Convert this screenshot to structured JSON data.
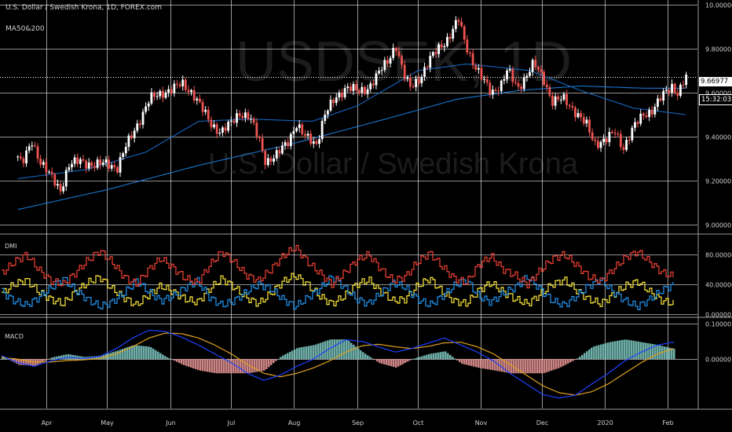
{
  "header": {
    "symbol_title": "U.S. Dollar / Swedish Krona, 1D, FOREX.com",
    "study_label": "MA50&200",
    "watermark_symbol": "USDSEK, 1D",
    "watermark_name": "U.S. Dollar / Swedish Krona"
  },
  "price_boxes": {
    "last_price": "9.66977",
    "countdown": "15:32:03"
  },
  "colors": {
    "background": "#000000",
    "grid": "#ffffff",
    "candle_up": "#ffffff",
    "candle_down": "#ef5350",
    "ma50": "#1565c0",
    "ma200": "#1976d2",
    "di_plus": "#2196f3",
    "di_minus": "#f44336",
    "adx": "#ffeb3b",
    "macd_line": "#1e40ff",
    "signal_line": "#e0a020",
    "hist_pos": "#80cbc4",
    "hist_neg": "#ef9a9a"
  },
  "chart_data": [
    {
      "type": "candlestick",
      "title": "U.S. Dollar / Swedish Krona, 1D, FOREX.com",
      "x_tick_labels": [
        "Apr",
        "May",
        "Jun",
        "Jul",
        "Aug",
        "Sep",
        "Oct",
        "Nov",
        "Dec",
        "2020",
        "Feb"
      ],
      "y_tick_labels": [
        "9.00000",
        "9.20000",
        "9.40000",
        "9.60000",
        "9.80000",
        "10.00000"
      ],
      "ylim": [
        8.98,
        10.02
      ],
      "close_path": [
        [
          "2019-03-18",
          9.31
        ],
        [
          "2019-03-20",
          9.27
        ],
        [
          "2019-03-25",
          9.38
        ],
        [
          "2019-03-29",
          9.29
        ],
        [
          "2019-04-03",
          9.22
        ],
        [
          "2019-04-08",
          9.16
        ],
        [
          "2019-04-12",
          9.27
        ],
        [
          "2019-04-18",
          9.29
        ],
        [
          "2019-04-25",
          9.27
        ],
        [
          "2019-05-01",
          9.28
        ],
        [
          "2019-05-06",
          9.26
        ],
        [
          "2019-05-10",
          9.35
        ],
        [
          "2019-05-16",
          9.46
        ],
        [
          "2019-05-22",
          9.57
        ],
        [
          "2019-05-28",
          9.6
        ],
        [
          "2019-06-03",
          9.62
        ],
        [
          "2019-06-07",
          9.64
        ],
        [
          "2019-06-12",
          9.6
        ],
        [
          "2019-06-17",
          9.52
        ],
        [
          "2019-06-21",
          9.46
        ],
        [
          "2019-06-26",
          9.42
        ],
        [
          "2019-07-01",
          9.46
        ],
        [
          "2019-07-05",
          9.51
        ],
        [
          "2019-07-10",
          9.49
        ],
        [
          "2019-07-15",
          9.38
        ],
        [
          "2019-07-18",
          9.29
        ],
        [
          "2019-07-23",
          9.31
        ],
        [
          "2019-07-29",
          9.38
        ],
        [
          "2019-08-02",
          9.46
        ],
        [
          "2019-08-06",
          9.4
        ],
        [
          "2019-08-12",
          9.37
        ],
        [
          "2019-08-16",
          9.5
        ],
        [
          "2019-08-22",
          9.58
        ],
        [
          "2019-08-27",
          9.63
        ],
        [
          "2019-09-02",
          9.6
        ],
        [
          "2019-09-06",
          9.62
        ],
        [
          "2019-09-11",
          9.68
        ],
        [
          "2019-09-16",
          9.74
        ],
        [
          "2019-09-20",
          9.82
        ],
        [
          "2019-09-24",
          9.68
        ],
        [
          "2019-09-27",
          9.62
        ],
        [
          "2019-10-02",
          9.67
        ],
        [
          "2019-10-07",
          9.75
        ],
        [
          "2019-10-11",
          9.8
        ],
        [
          "2019-10-16",
          9.85
        ],
        [
          "2019-10-21",
          9.93
        ],
        [
          "2019-10-24",
          9.83
        ],
        [
          "2019-10-28",
          9.74
        ],
        [
          "2019-11-01",
          9.67
        ],
        [
          "2019-11-06",
          9.6
        ],
        [
          "2019-11-11",
          9.64
        ],
        [
          "2019-11-14",
          9.7
        ],
        [
          "2019-11-19",
          9.62
        ],
        [
          "2019-11-22",
          9.66
        ],
        [
          "2019-11-27",
          9.73
        ],
        [
          "2019-12-02",
          9.66
        ],
        [
          "2019-12-06",
          9.56
        ],
        [
          "2019-12-12",
          9.57
        ],
        [
          "2019-12-17",
          9.52
        ],
        [
          "2019-12-23",
          9.45
        ],
        [
          "2019-12-27",
          9.37
        ],
        [
          "2020-01-02",
          9.39
        ],
        [
          "2020-01-06",
          9.42
        ],
        [
          "2020-01-10",
          9.35
        ],
        [
          "2020-01-15",
          9.44
        ],
        [
          "2020-01-20",
          9.5
        ],
        [
          "2020-01-24",
          9.52
        ],
        [
          "2020-01-29",
          9.58
        ],
        [
          "2020-02-03",
          9.63
        ],
        [
          "2020-02-06",
          9.6
        ],
        [
          "2020-02-10",
          9.67
        ]
      ],
      "ma50_path": [
        [
          "2019-03-18",
          9.21
        ],
        [
          "2019-04-20",
          9.25
        ],
        [
          "2019-05-20",
          9.33
        ],
        [
          "2019-06-15",
          9.47
        ],
        [
          "2019-07-10",
          9.48
        ],
        [
          "2019-08-10",
          9.47
        ],
        [
          "2019-09-01",
          9.54
        ],
        [
          "2019-10-01",
          9.7
        ],
        [
          "2019-10-25",
          9.73
        ],
        [
          "2019-11-25",
          9.7
        ],
        [
          "2019-12-20",
          9.61
        ],
        [
          "2020-01-15",
          9.53
        ],
        [
          "2020-02-10",
          9.5
        ]
      ],
      "ma200_path": [
        [
          "2019-03-18",
          9.07
        ],
        [
          "2019-05-01",
          9.16
        ],
        [
          "2019-06-15",
          9.27
        ],
        [
          "2019-08-01",
          9.37
        ],
        [
          "2019-09-15",
          9.48
        ],
        [
          "2019-10-20",
          9.57
        ],
        [
          "2019-11-20",
          9.61
        ],
        [
          "2019-12-20",
          9.63
        ],
        [
          "2020-01-20",
          9.62
        ],
        [
          "2020-02-10",
          9.62
        ]
      ]
    },
    {
      "type": "line",
      "title": "DMI",
      "y_tick_labels": [
        "0.00000",
        "40.00000",
        "80.00000"
      ],
      "ylim": [
        0,
        100
      ],
      "series": [
        {
          "name": "",
          "color_key": "di_minus",
          "values": [
            55,
            70,
            80,
            60,
            45,
            40,
            55,
            72,
            85,
            70,
            50,
            40,
            60,
            75,
            62,
            48,
            42,
            66,
            84,
            70,
            52,
            45,
            60,
            78,
            90,
            70,
            55,
            40,
            55,
            72,
            80,
            60,
            45,
            50,
            70,
            82,
            64,
            48,
            42,
            66,
            78,
            60,
            52,
            40,
            58,
            74,
            80,
            66,
            50,
            44,
            60,
            76,
            84,
            70,
            56,
            50
          ]
        },
        {
          "name": "",
          "color_key": "di_plus",
          "values": [
            30,
            18,
            12,
            22,
            35,
            48,
            32,
            20,
            10,
            16,
            28,
            45,
            30,
            18,
            24,
            36,
            44,
            22,
            12,
            18,
            30,
            40,
            34,
            20,
            10,
            22,
            34,
            50,
            36,
            20,
            14,
            28,
            42,
            36,
            20,
            12,
            24,
            38,
            46,
            24,
            16,
            28,
            36,
            50,
            34,
            18,
            12,
            24,
            38,
            46,
            30,
            18,
            10,
            20,
            32,
            40
          ]
        },
        {
          "name": "",
          "color_key": "adx",
          "values": [
            28,
            40,
            46,
            30,
            20,
            14,
            30,
            42,
            50,
            34,
            22,
            12,
            26,
            38,
            30,
            20,
            16,
            34,
            48,
            36,
            22,
            14,
            28,
            44,
            52,
            40,
            24,
            14,
            24,
            40,
            46,
            30,
            18,
            20,
            38,
            48,
            30,
            18,
            14,
            32,
            42,
            30,
            20,
            14,
            26,
            40,
            46,
            32,
            20,
            14,
            26,
            38,
            44,
            30,
            18,
            14
          ]
        }
      ]
    },
    {
      "type": "line",
      "title": "MACD",
      "y_tick_labels": [
        "0.00000",
        "0.10000"
      ],
      "ylim": [
        -0.135,
        0.105
      ],
      "series": [
        {
          "name": "",
          "color_key": "macd_line",
          "values": [
            0.01,
            -0.01,
            -0.02,
            -0.005,
            0.005,
            0.002,
            0.008,
            0.03,
            0.06,
            0.082,
            0.078,
            0.062,
            0.04,
            0.015,
            -0.01,
            -0.04,
            -0.06,
            -0.045,
            -0.02,
            0.0,
            0.03,
            0.055,
            0.05,
            0.035,
            0.02,
            0.03,
            0.045,
            0.06,
            0.04,
            0.02,
            -0.005,
            -0.04,
            -0.07,
            -0.1,
            -0.11,
            -0.102,
            -0.07,
            -0.04,
            -0.005,
            0.02,
            0.04,
            0.048
          ]
        },
        {
          "name": "",
          "color_key": "signal_line",
          "values": [
            0.005,
            0.0,
            -0.008,
            -0.008,
            -0.004,
            -0.002,
            0.002,
            0.015,
            0.035,
            0.06,
            0.074,
            0.072,
            0.06,
            0.04,
            0.015,
            -0.015,
            -0.04,
            -0.05,
            -0.04,
            -0.025,
            -0.005,
            0.02,
            0.038,
            0.042,
            0.035,
            0.03,
            0.036,
            0.046,
            0.048,
            0.035,
            0.015,
            -0.015,
            -0.045,
            -0.075,
            -0.095,
            -0.102,
            -0.092,
            -0.07,
            -0.04,
            -0.01,
            0.015,
            0.03
          ]
        }
      ]
    }
  ]
}
